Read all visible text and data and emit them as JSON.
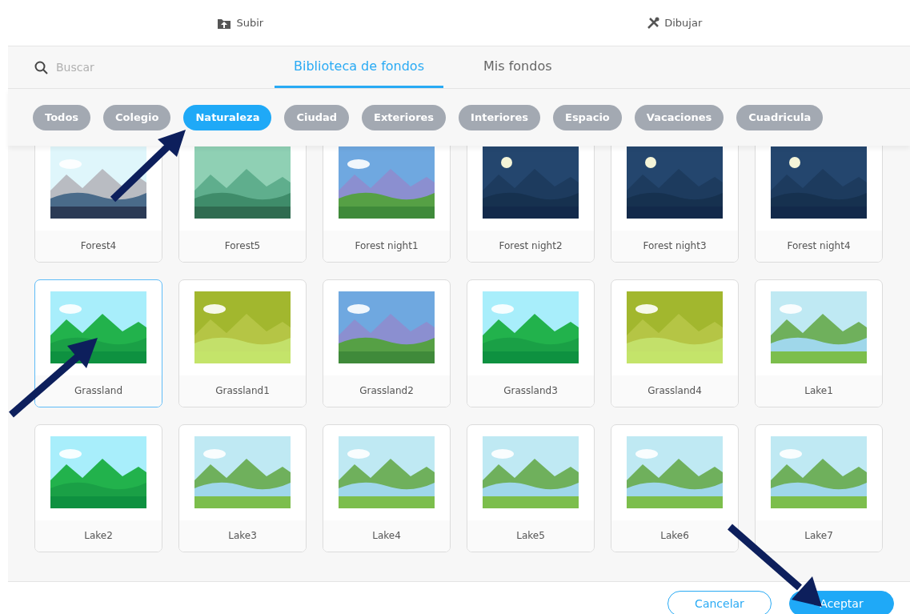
{
  "top_actions": [
    {
      "kind": "upload",
      "label": "Subir"
    },
    {
      "kind": "draw",
      "label": "Dibujar"
    }
  ],
  "search": {
    "placeholder": "Buscar"
  },
  "tabs": [
    {
      "label": "Biblioteca de fondos",
      "selected": true
    },
    {
      "label": "Mis fondos",
      "selected": false
    }
  ],
  "categories": [
    {
      "label": "Todos",
      "selected": false
    },
    {
      "label": "Colegio",
      "selected": false
    },
    {
      "label": "Naturaleza",
      "selected": true
    },
    {
      "label": "Ciudad",
      "selected": false
    },
    {
      "label": "Exteriores",
      "selected": false
    },
    {
      "label": "Interiores",
      "selected": false
    },
    {
      "label": "Espacio",
      "selected": false
    },
    {
      "label": "Vacaciones",
      "selected": false
    },
    {
      "label": "Cuadricula",
      "selected": false
    }
  ],
  "backgrounds": [
    {
      "label": "Forest4",
      "kind": "forest",
      "selected": false
    },
    {
      "label": "Forest5",
      "kind": "woods",
      "selected": false
    },
    {
      "label": "Forest night1",
      "kind": "hills",
      "selected": false
    },
    {
      "label": "Forest night2",
      "kind": "night",
      "selected": false
    },
    {
      "label": "Forest night3",
      "kind": "night",
      "selected": false
    },
    {
      "label": "Forest night4",
      "kind": "night",
      "selected": false
    },
    {
      "label": "Grassland",
      "kind": "grassland",
      "selected": true
    },
    {
      "label": "Grassland1",
      "kind": "meadow",
      "selected": false
    },
    {
      "label": "Grassland2",
      "kind": "hills",
      "selected": false
    },
    {
      "label": "Grassland3",
      "kind": "grassland",
      "selected": false
    },
    {
      "label": "Grassland4",
      "kind": "meadow",
      "selected": false
    },
    {
      "label": "Lake1",
      "kind": "lake",
      "selected": false
    },
    {
      "label": "Lake2",
      "kind": "grassland",
      "selected": false
    },
    {
      "label": "Lake3",
      "kind": "lake",
      "selected": false
    },
    {
      "label": "Lake4",
      "kind": "lake",
      "selected": false
    },
    {
      "label": "Lake5",
      "kind": "lake",
      "selected": false
    },
    {
      "label": "Lake6",
      "kind": "lake",
      "selected": false
    },
    {
      "label": "Lake7",
      "kind": "lake",
      "selected": false
    }
  ],
  "footer_buttons": [
    {
      "kind": "secondary",
      "label": "Cancelar"
    },
    {
      "kind": "primary",
      "label": "Aceptar"
    }
  ]
}
